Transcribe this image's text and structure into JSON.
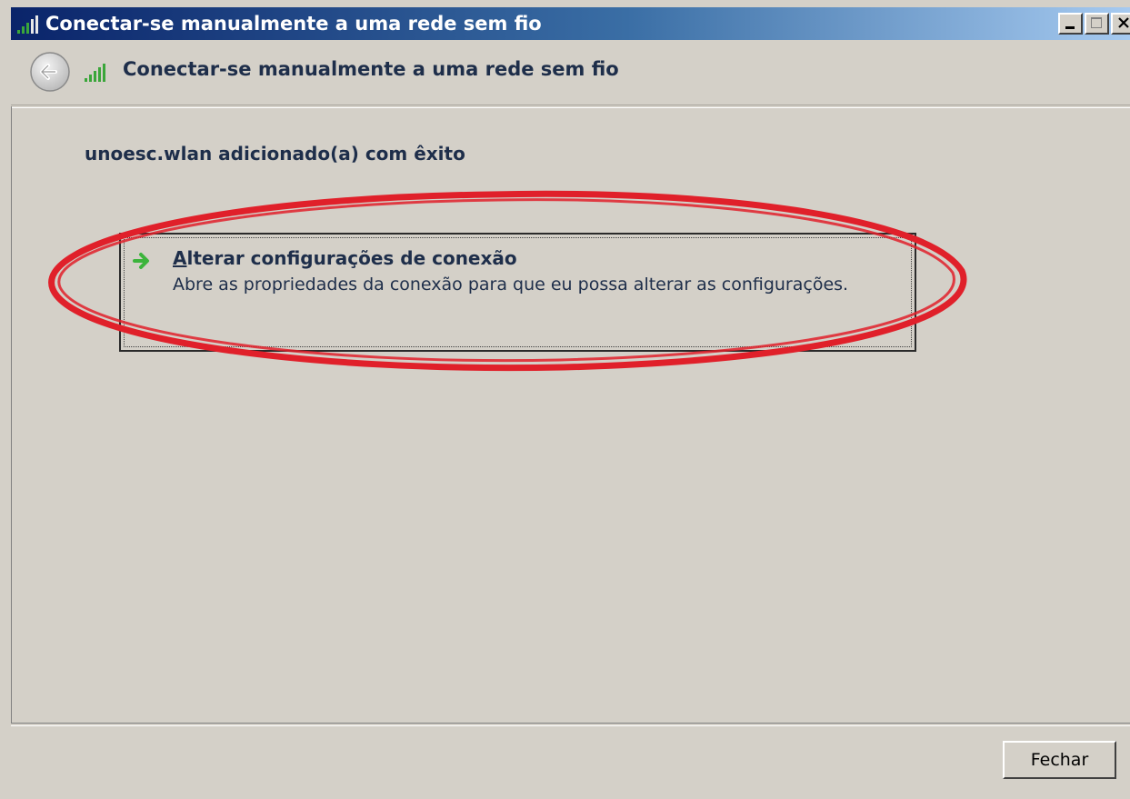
{
  "window": {
    "title": "Conectar-se manualmente a uma rede sem fio",
    "title_icon": "wireless-signal-icon",
    "controls": {
      "minimize": "minimize-icon",
      "maximize": "maximize-icon",
      "close": "close-icon"
    }
  },
  "header": {
    "back_icon": "back-arrow-icon",
    "icon": "wireless-signal-icon",
    "title": "Conectar-se manualmente a uma rede sem fio"
  },
  "main": {
    "success_message": "unoesc.wlan adicionado(a) com êxito",
    "command_link": {
      "icon": "green-arrow-icon",
      "accelerator": "A",
      "title_rest": "lterar configurações de conexão",
      "description": "Abre as propriedades da conexão para que eu possa alterar as configurações."
    }
  },
  "footer": {
    "close_label": "Fechar"
  },
  "colors": {
    "title_bar_start": "#0a246a",
    "title_bar_end": "#a6caf0",
    "text": "#1e2e4a",
    "annotation": "#e0202a",
    "link_arrow": "#3cb43c",
    "background": "#d4d0c8"
  }
}
